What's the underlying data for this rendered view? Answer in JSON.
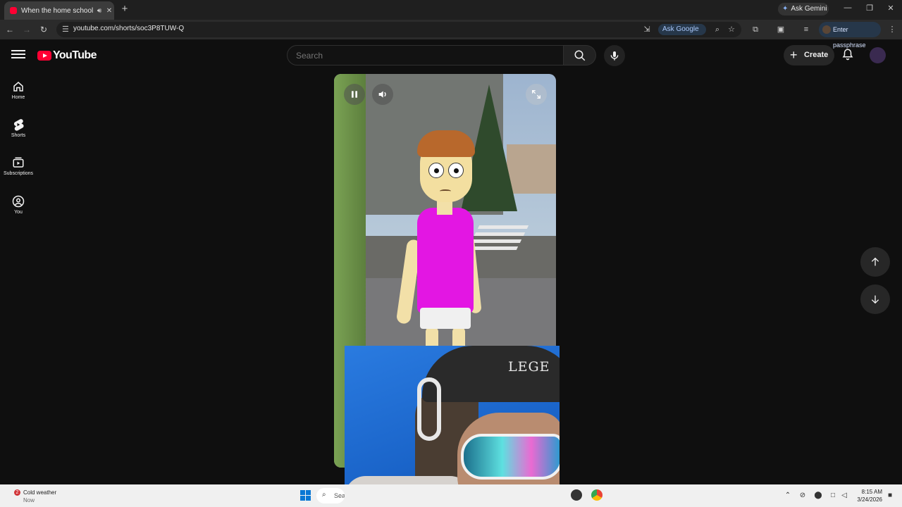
{
  "browser": {
    "tab_title": "When the home school pro",
    "url": "youtube.com/shorts/soc3P8TUW-Q",
    "ask_gemini": "Ask Gemini",
    "ask_google": "Ask Google",
    "passphrase_label": "Enter passphrase"
  },
  "header": {
    "logo_text": "YouTube",
    "search_placeholder": "Search",
    "create_label": "Create"
  },
  "sidebar": {
    "items": [
      {
        "label": "Home",
        "icon": "home-icon"
      },
      {
        "label": "Shorts",
        "icon": "shorts-icon"
      },
      {
        "label": "Subscriptions",
        "icon": "subscriptions-icon"
      },
      {
        "label": "You",
        "icon": "you-icon"
      }
    ]
  },
  "webcam": {
    "cap_text": "LEGE"
  },
  "taskbar": {
    "weather_text": "Cold weather",
    "weather_sub": "Now",
    "weather_badge": "2",
    "search_text": "Sea",
    "time": "8:15 AM",
    "date": "3/24/2026"
  },
  "colors": {
    "brand": "#ff0033",
    "background": "#0f0f0f",
    "shirt": "#e316e3"
  }
}
